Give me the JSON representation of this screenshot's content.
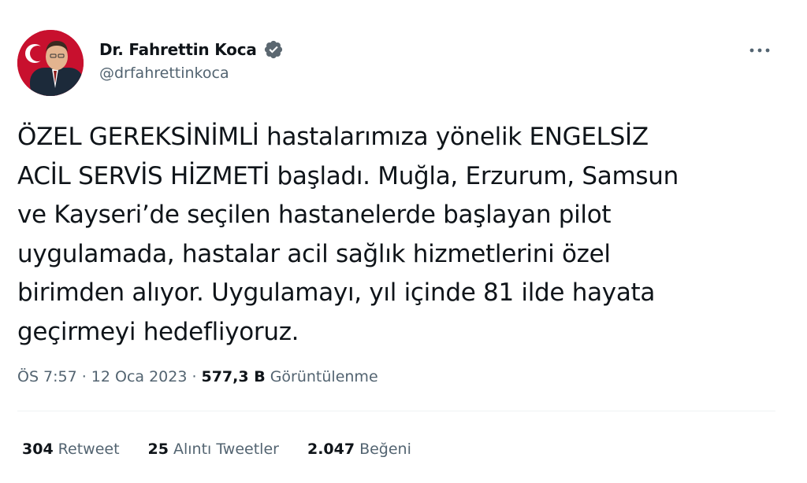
{
  "author": {
    "display_name": "Dr. Fahrettin Koca",
    "handle": "@drfahrettinkoca",
    "verified": true
  },
  "tweet": {
    "text": "ÖZEL GEREKSİNİMLİ hastalarımıza yönelik ENGELSİZ\nACİL SERVİS HİZMETİ başladı. Muğla, Erzurum, Samsun\nve Kayseri’de seçilen hastanelerde başlayan pilot\nuygulamada, hastalar acil sağlık hizmetlerini özel\nbirimden alıyor. Uygulamayı, yıl içinde 81 ilde hayata\ngeçirmeyi hedefliyoruz."
  },
  "meta": {
    "time": "ÖS 7:57",
    "separator": "·",
    "date": "12 Oca 2023",
    "views_count": "577,3 B",
    "views_label": "Görüntülenme"
  },
  "stats": {
    "retweets_count": "304",
    "retweets_label": "Retweet",
    "quotes_count": "25",
    "quotes_label": "Alıntı Tweetler",
    "likes_count": "2.047",
    "likes_label": "Beğeni"
  },
  "colors": {
    "text_primary": "#0f1419",
    "text_secondary": "#536471",
    "verified_blue": "#1d9bf0",
    "divider": "#eff3f4",
    "avatar_background": "#c8102e"
  },
  "icons": {
    "verified": "verified-badge-icon",
    "more": "more-options-icon"
  }
}
